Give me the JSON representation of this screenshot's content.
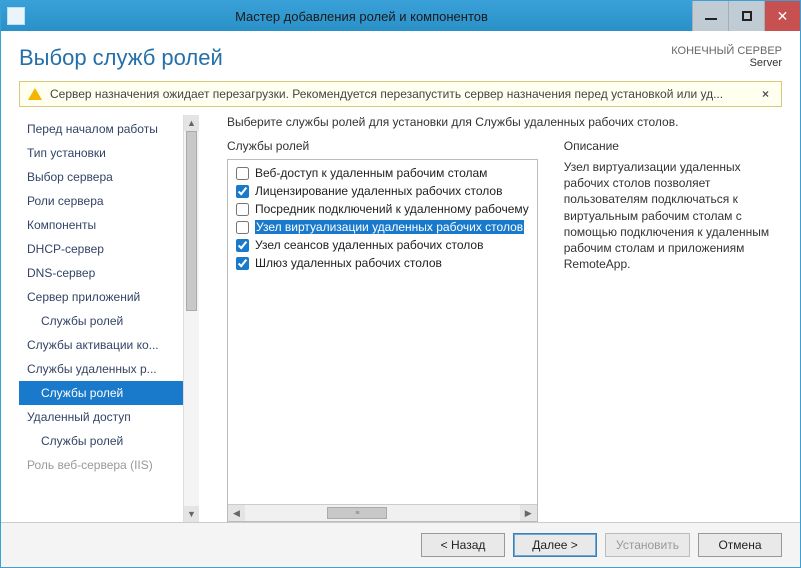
{
  "titlebar": {
    "title": "Мастер добавления ролей и компонентов"
  },
  "heading": "Выбор служб ролей",
  "destination": {
    "label": "КОНЕЧНЫЙ СЕРВЕР",
    "name": "Server"
  },
  "warning": {
    "text": "Сервер назначения ожидает перезагрузки. Рекомендуется перезапустить сервер назначения перед установкой или уд...",
    "close": "×"
  },
  "sidebar": {
    "items": [
      {
        "label": "Перед началом работы",
        "sub": false
      },
      {
        "label": "Тип установки",
        "sub": false
      },
      {
        "label": "Выбор сервера",
        "sub": false
      },
      {
        "label": "Роли сервера",
        "sub": false
      },
      {
        "label": "Компоненты",
        "sub": false
      },
      {
        "label": "DHCP-сервер",
        "sub": false
      },
      {
        "label": "DNS-сервер",
        "sub": false
      },
      {
        "label": "Сервер приложений",
        "sub": false
      },
      {
        "label": "Службы ролей",
        "sub": true
      },
      {
        "label": "Службы активации ко...",
        "sub": false
      },
      {
        "label": "Службы удаленных р...",
        "sub": false
      },
      {
        "label": "Службы ролей",
        "sub": true,
        "selected": true
      },
      {
        "label": "Удаленный доступ",
        "sub": false
      },
      {
        "label": "Службы ролей",
        "sub": true
      },
      {
        "label": "Роль веб-сервера (IIS)",
        "sub": false,
        "disabled": true
      }
    ]
  },
  "instruction": "Выберите службы ролей для установки для Службы удаленных рабочих столов.",
  "roles": {
    "heading": "Службы ролей",
    "items": [
      {
        "label": "Веб-доступ к удаленным рабочим столам",
        "checked": false
      },
      {
        "label": "Лицензирование удаленных рабочих столов",
        "checked": true
      },
      {
        "label": "Посредник подключений к удаленному рабочему",
        "checked": false
      },
      {
        "label": "Узел виртуализации удаленных рабочих столов",
        "checked": false,
        "highlight": true
      },
      {
        "label": "Узел сеансов удаленных рабочих столов",
        "checked": true
      },
      {
        "label": "Шлюз удаленных рабочих столов",
        "checked": true
      }
    ]
  },
  "description": {
    "heading": "Описание",
    "text": "Узел виртуализации удаленных рабочих столов  позволяет пользователям подключаться к виртуальным рабочим столам с помощью подключения к удаленным рабочим столам и приложениям RemoteApp."
  },
  "footer": {
    "back": "< Назад",
    "next": "Далее >",
    "install": "Установить",
    "cancel": "Отмена"
  }
}
